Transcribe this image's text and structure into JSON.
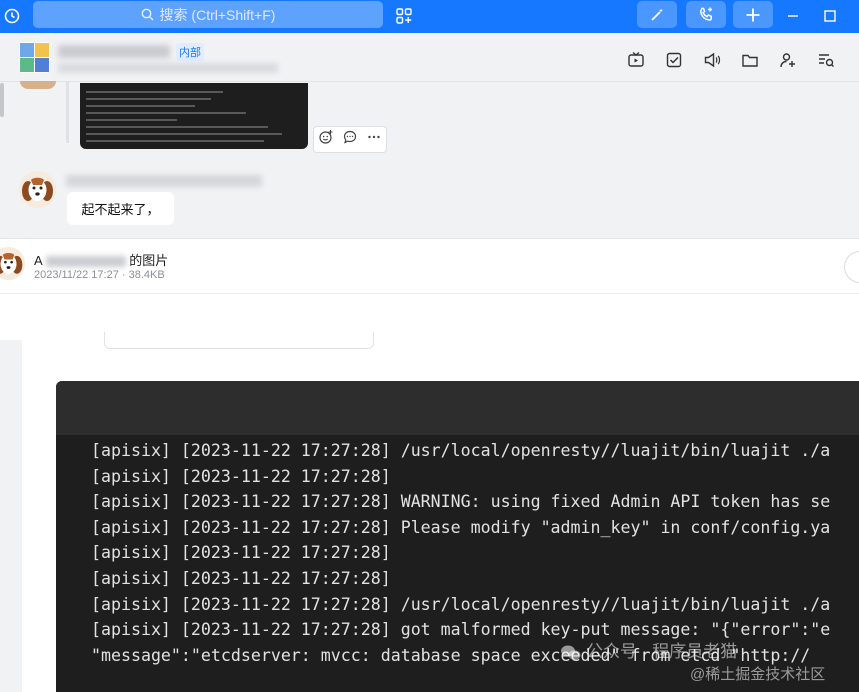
{
  "topbar": {
    "search_placeholder": "搜索 (Ctrl+Shift+F)",
    "icons": [
      "history-icon",
      "search-icon",
      "apps-icon",
      "magic-wand-icon",
      "phone-call-icon",
      "plus-icon",
      "minimize-icon",
      "maximize-icon"
    ]
  },
  "chat": {
    "group_tag": "内部",
    "header_icons": [
      "live-icon",
      "todo-icon",
      "announce-icon",
      "folder-icon",
      "add-member-icon",
      "search-history-icon"
    ],
    "message_text": "起不起来了，",
    "reactions": [
      "emoji-add-icon",
      "reply-icon",
      "more-icon"
    ]
  },
  "viewer": {
    "title_suffix": "的图片",
    "title_prefix": "A",
    "meta": "2023/11/22 17:27 · 38.4KB"
  },
  "terminal": {
    "lines": [
      "[apisix] [2023-11-22 17:27:28] /usr/local/openresty//luajit/bin/luajit ./a",
      "[apisix] [2023-11-22 17:27:28]",
      "[apisix] [2023-11-22 17:27:28] WARNING: using fixed Admin API token has se",
      "[apisix] [2023-11-22 17:27:28] Please modify \"admin_key\" in conf/config.ya",
      "[apisix] [2023-11-22 17:27:28]",
      "[apisix] [2023-11-22 17:27:28]",
      "[apisix] [2023-11-22 17:27:28] /usr/local/openresty//luajit/bin/luajit ./a",
      "[apisix] [2023-11-22 17:27:28] got malformed key-put message: \"{\"error\":\"e",
      "\"message\":\"etcdserver: mvcc: database space exceeded\" from etcd \"http://"
    ]
  },
  "watermark": {
    "line1": "公众号 · 程序员老猫",
    "line2": "@稀土掘金技术社区"
  }
}
